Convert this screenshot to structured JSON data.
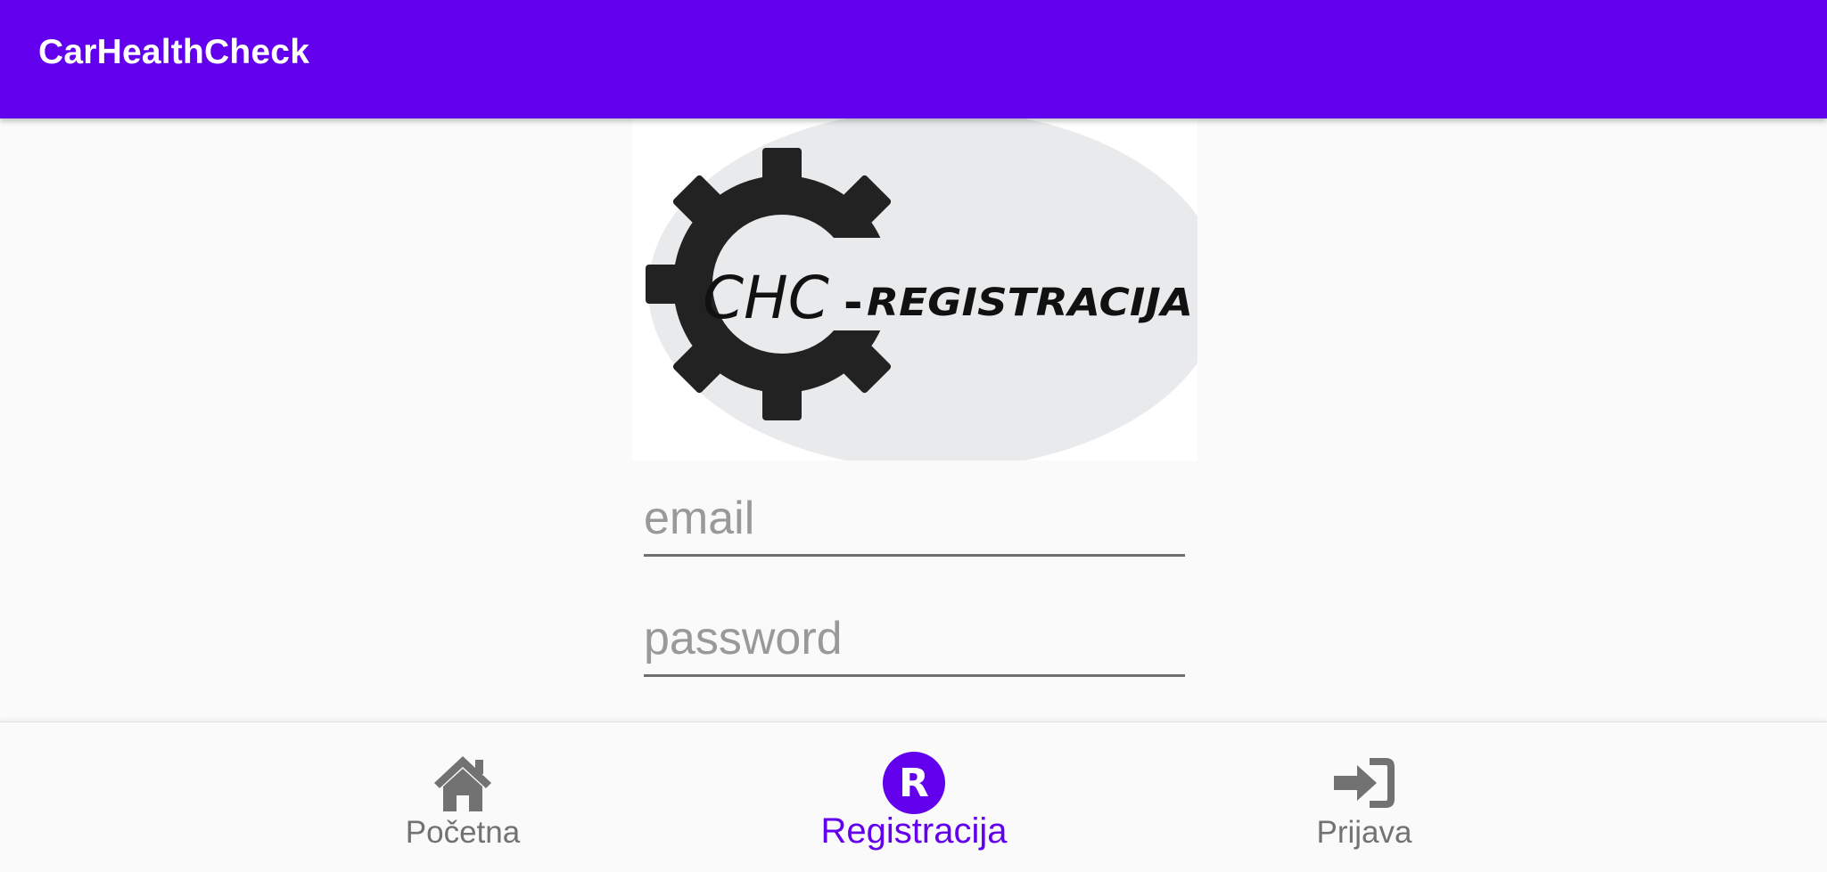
{
  "app_bar": {
    "title": "CarHealthCheck",
    "background": "#6200ee"
  },
  "logo": {
    "icon": "gear-icon",
    "brand_text": "CHC",
    "dash": "-",
    "subtitle": "REGISTRACIJA"
  },
  "form": {
    "email": {
      "placeholder": "email",
      "value": ""
    },
    "password": {
      "placeholder": "password",
      "value": ""
    }
  },
  "bottom_nav": {
    "items": [
      {
        "label": "Početna",
        "icon": "home-icon",
        "active": false
      },
      {
        "label": "Registracija",
        "icon": "register-r-icon",
        "active": true
      },
      {
        "label": "Prijava",
        "icon": "sign-in-icon",
        "active": false
      }
    ],
    "active_color": "#6200ee",
    "inactive_color": "#727272"
  }
}
